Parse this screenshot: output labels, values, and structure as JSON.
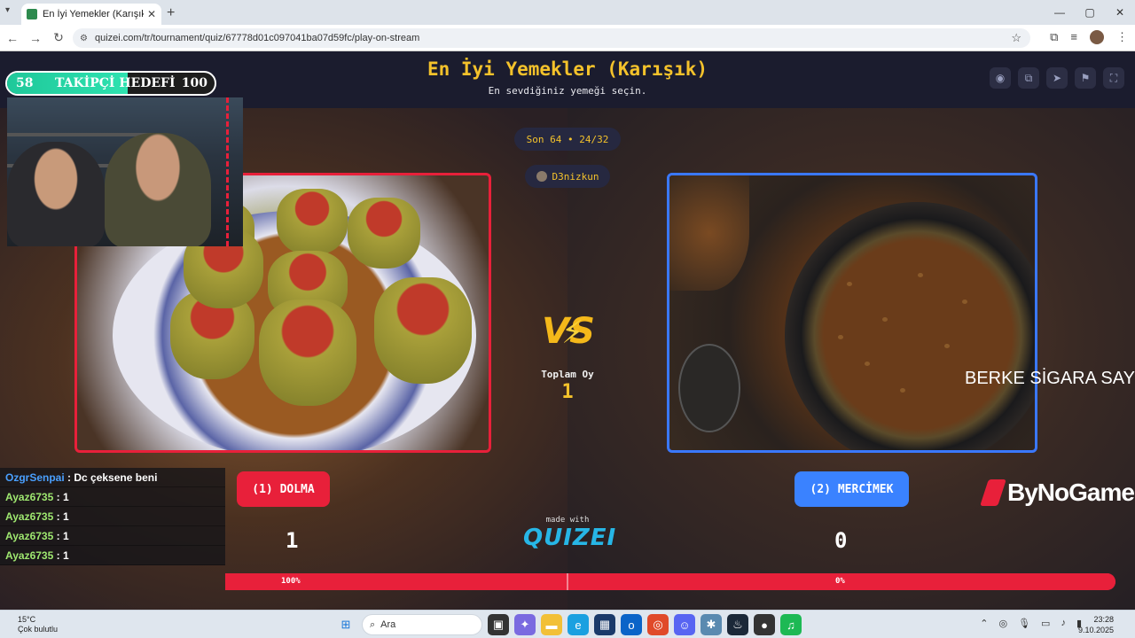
{
  "browser": {
    "tab_title": "En İyi Yemekler (Karışık) - Quizei",
    "tab_close": "✕",
    "new_tab": "+",
    "url": "quizei.com/tr/tournament/quiz/67778d01c097041ba07d59fc/play-on-stream",
    "window_controls": [
      "—",
      "▢",
      "✕"
    ]
  },
  "header": {
    "title": "En İyi Yemekler (Karışık)",
    "subtitle": "En sevdiğiniz yemeği seçin.",
    "icons": [
      "eye-icon",
      "copy-icon",
      "send-icon",
      "flag-icon",
      "fullscreen-icon"
    ]
  },
  "round": {
    "label": "Son 64 • 24/32",
    "voter": "D3nizkun"
  },
  "matchup": {
    "vs_label": "VS",
    "total_votes_label": "Toplam Oy",
    "total_votes": "1",
    "left": {
      "label": "(1) DOLMA",
      "score": "1",
      "percent": "100%",
      "accent": "#e8203a"
    },
    "right": {
      "label": "(2) MERCİMEK",
      "score": "0",
      "percent": "0%",
      "accent": "#3a82ff"
    },
    "progress_fraction": 1.0
  },
  "branding": {
    "made_with": "made with",
    "logo": "QUIZEI",
    "sponsor": "ByNoGame"
  },
  "overlay": {
    "ticker": "BERKE SİGARA SAY",
    "goal": {
      "current": "58",
      "label": "TAKİPÇİ HEDEFİ",
      "target": "100",
      "fill_fraction": 0.58
    }
  },
  "chat": [
    {
      "user": "OzgrSenpai",
      "message": "Dc çeksene beni"
    },
    {
      "user": "Ayaz6735",
      "message": "1"
    },
    {
      "user": "Ayaz6735",
      "message": "1"
    },
    {
      "user": "Ayaz6735",
      "message": "1"
    },
    {
      "user": "Ayaz6735",
      "message": "1"
    }
  ],
  "taskbar": {
    "weather_temp": "15°C",
    "weather_desc": "Çok bulutlu",
    "search_placeholder": "Ara",
    "time": "23:28",
    "date": "9.10.2025"
  }
}
